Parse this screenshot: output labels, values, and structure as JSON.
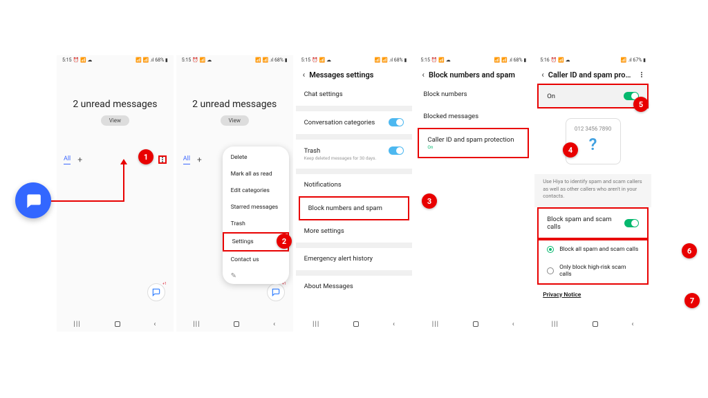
{
  "status": {
    "time1": "5:15",
    "time2": "5:16",
    "icons_left": "⏰ 📶 ☁",
    "right": "📶 📶 .ıl 68% ▮",
    "right67": "📶 .ıl 67% ▮"
  },
  "p1": {
    "title": "2 unread messages",
    "view": "View",
    "tab_all": "All"
  },
  "menu": {
    "items": [
      "Delete",
      "Mark all as read",
      "Edit categories",
      "Starred messages",
      "Trash",
      "Settings",
      "Contact us"
    ]
  },
  "p3": {
    "header": "Messages settings",
    "chat": "Chat settings",
    "conv": "Conversation categories",
    "trash": "Trash",
    "trash_sub": "Keep deleted messages for 30 days.",
    "notif": "Notifications",
    "block": "Block numbers and spam",
    "more": "More settings",
    "emerg": "Emergency alert history",
    "about": "About Messages"
  },
  "p4": {
    "header": "Block numbers and spam",
    "block_nums": "Block numbers",
    "block_msgs": "Blocked messages",
    "callerid": "Caller ID and spam protection",
    "callerid_sub": "On"
  },
  "p5": {
    "header": "Caller ID and spam pro…",
    "on": "On",
    "preview_num": "012 3456 7890",
    "info": "Use Hiya to identify spam and scam callers as well as other callers who aren't in your contacts.",
    "block_toggle": "Block spam and scam calls",
    "radio1": "Block all spam and scam calls",
    "radio2": "Only block high-risk scam calls",
    "privacy": "Privacy Notice"
  },
  "callouts": {
    "1": "1",
    "2": "2",
    "3": "3",
    "4": "4",
    "5": "5",
    "6": "6",
    "7": "7"
  },
  "fab_badge": "+1"
}
